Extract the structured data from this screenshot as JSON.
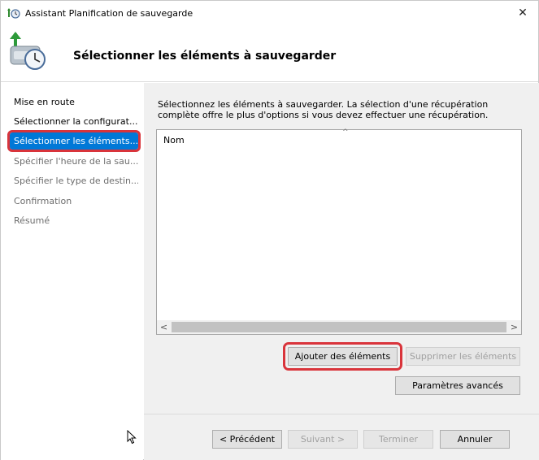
{
  "window": {
    "title": "Assistant Planification de sauvegarde",
    "close_glyph": "✕"
  },
  "header": {
    "heading": "Sélectionner les éléments à sauvegarder"
  },
  "nav": {
    "items": [
      {
        "label": "Mise en route",
        "state": "normal"
      },
      {
        "label": "Sélectionner la configurat...",
        "state": "normal"
      },
      {
        "label": "Sélectionner les éléments...",
        "state": "active"
      },
      {
        "label": "Spécifier l'heure de la sau...",
        "state": "disabled"
      },
      {
        "label": "Spécifier le type de destin...",
        "state": "disabled"
      },
      {
        "label": "Confirmation",
        "state": "disabled"
      },
      {
        "label": "Résumé",
        "state": "disabled"
      }
    ]
  },
  "main": {
    "instruction": "Sélectionnez les éléments à sauvegarder. La sélection d'une récupération complète offre le plus d'options si vous devez effectuer une récupération.",
    "list": {
      "column_header": "Nom",
      "sort_glyph": "^",
      "scroll_left": "<",
      "scroll_right": ">"
    },
    "buttons": {
      "add_items": "Ajouter des éléments",
      "remove_items": "Supprimer les éléments",
      "advanced": "Paramètres avancés"
    }
  },
  "footer": {
    "previous": "< Précédent",
    "next": "Suivant >",
    "finish": "Terminer",
    "cancel": "Annuler"
  },
  "icons": {
    "app": "backup-schedule-icon",
    "header": "backup-clock-icon",
    "close": "close-icon",
    "pointer": "mouse-pointer-icon"
  },
  "colors": {
    "accent": "#0078d7",
    "annotation_ring": "#d9343b",
    "panel_bg": "#f0f0f0"
  }
}
